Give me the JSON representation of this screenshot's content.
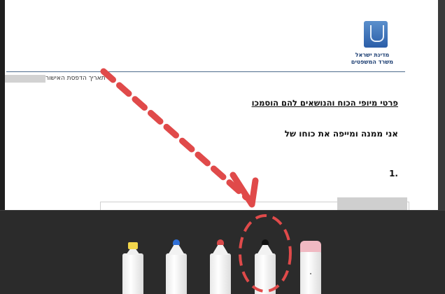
{
  "document": {
    "ministry_line1": "מדינת ישראל",
    "ministry_line2": "משרד המשפטים",
    "print_date_label": "תאריך הדפסת האישור",
    "heading": "פרטי מיופי הכוח והנושאים להם הוסמכו",
    "line1": "אני ממנה ומייפה את כוחו של",
    "item_number": "1."
  },
  "toolbar": {
    "tools": [
      {
        "name": "highlighter",
        "tip_color": "#f2d64b"
      },
      {
        "name": "pen",
        "tip_color": "#2f6fd6"
      },
      {
        "name": "pen",
        "tip_color": "#d94a4a"
      },
      {
        "name": "pen",
        "tip_color": "#111111",
        "selected": true
      },
      {
        "name": "eraser",
        "tip_color": "#f0b9c2"
      }
    ]
  },
  "annotation": {
    "arrow_color": "#e04a4a",
    "circle_color": "#e04a4a"
  }
}
